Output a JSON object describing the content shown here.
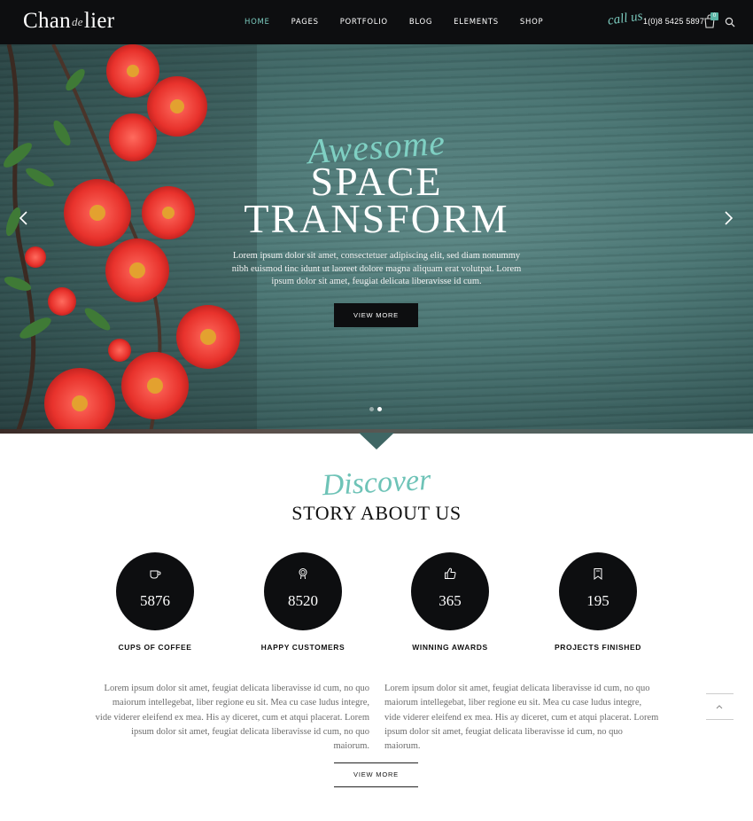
{
  "header": {
    "logo_left": "Chan",
    "logo_mid": "de",
    "logo_right": "lier",
    "menu": [
      "HOME",
      "PAGES",
      "PORTFOLIO",
      "BLOG",
      "ELEMENTS",
      "SHOP"
    ],
    "active_menu": "HOME",
    "call_label": "call us",
    "phone": "1(0)8 5425 5897",
    "cart_count": "0",
    "icons": [
      "cart-icon",
      "search-icon"
    ]
  },
  "hero": {
    "script_title": "Awesome",
    "title_line1": "SPACE",
    "title_line2": "TRANSFORM",
    "text": "Lorem ipsum dolor sit amet, consectetuer adipiscing elit, sed diam nonummy nibh euismod tinc idunt ut laoreet dolore magna aliquam erat volutpat. Lorem ipsum dolor sit amet, feugiat delicata liberavisse id cum.",
    "button_label": "VIEW MORE",
    "slides": 2,
    "active_slide": 2,
    "icons": [
      "arrow-left-icon",
      "arrow-right-icon"
    ]
  },
  "about": {
    "script_title": "Discover",
    "title": "STORY ABOUT US",
    "stats": [
      {
        "number": "5876",
        "label": "CUPS OF COFFEE",
        "icon": "coffee-cup-icon"
      },
      {
        "number": "8520",
        "label": "HAPPY CUSTOMERS",
        "icon": "award-medal-icon"
      },
      {
        "number": "365",
        "label": "WINNING AWARDS",
        "icon": "thumbs-up-icon"
      },
      {
        "number": "195",
        "label": "PROJECTS FINISHED",
        "icon": "bookmark-icon"
      }
    ],
    "paragraph_left": "Lorem ipsum dolor sit amet, feugiat delicata liberavisse id cum, no quo maiorum intellegebat, liber regione eu sit. Mea cu case ludus integre, vide viderer eleifend ex mea. His ay diceret, cum et atqui placerat. Lorem ipsum dolor sit amet, feugiat delicata liberavisse id cum, no quo maiorum.",
    "paragraph_right": "Lorem ipsum dolor sit amet, feugiat delicata liberavisse id cum, no quo maiorum intellegebat, liber regione eu sit. Mea cu case ludus integre, vide viderer eleifend ex mea. His ay diceret, cum et atqui placerat. Lorem ipsum dolor sit amet, feugiat delicata liberavisse id cum, no quo maiorum.",
    "button_label": "VIEW MORE"
  },
  "colors": {
    "accent": "#7ac9bd",
    "dark": "#0d0e10",
    "hero_bg": "#4a7573"
  }
}
